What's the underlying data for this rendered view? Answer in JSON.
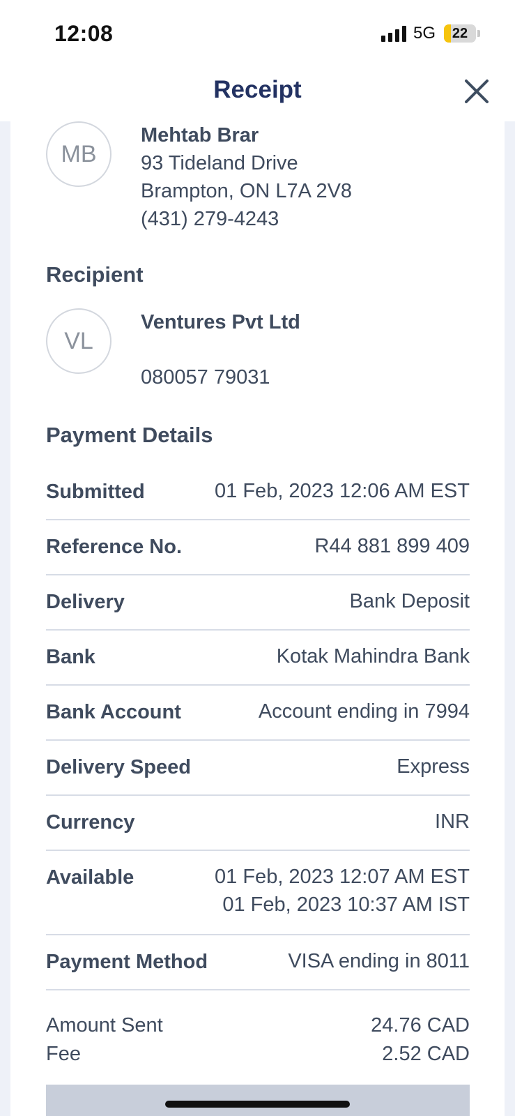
{
  "status": {
    "time": "12:08",
    "network": "5G",
    "battery": "22",
    "battery_level": 0.22
  },
  "header": {
    "title": "Receipt"
  },
  "sender": {
    "initials": "MB",
    "name": "Mehtab Brar",
    "address_line1": "93 Tideland Drive",
    "address_line2": "Brampton, ON L7A 2V8",
    "phone": "(431) 279-4243"
  },
  "recipient": {
    "section_title": "Recipient",
    "initials": "VL",
    "name": "Ventures Pvt Ltd",
    "account": "080057 79031"
  },
  "payment_details": {
    "section_title": "Payment Details",
    "rows": [
      {
        "label": "Submitted",
        "value": "01 Feb, 2023 12:06 AM EST"
      },
      {
        "label": "Reference No.",
        "value": "R44 881 899 409"
      },
      {
        "label": "Delivery",
        "value": "Bank Deposit"
      },
      {
        "label": "Bank",
        "value": "Kotak Mahindra Bank"
      },
      {
        "label": "Bank Account",
        "value": "Account ending in 7994"
      },
      {
        "label": "Delivery Speed",
        "value": "Express"
      },
      {
        "label": "Currency",
        "value": "INR"
      },
      {
        "label": "Available",
        "value": "01 Feb, 2023 12:07 AM EST",
        "value2": "01 Feb, 2023 10:37 AM IST"
      },
      {
        "label": "Payment Method",
        "value": "VISA ending in 8011"
      }
    ]
  },
  "summary": {
    "amount_sent_label": "Amount Sent",
    "amount_sent_value": "24.76 CAD",
    "fee_label": "Fee",
    "fee_value": "2.52 CAD"
  }
}
